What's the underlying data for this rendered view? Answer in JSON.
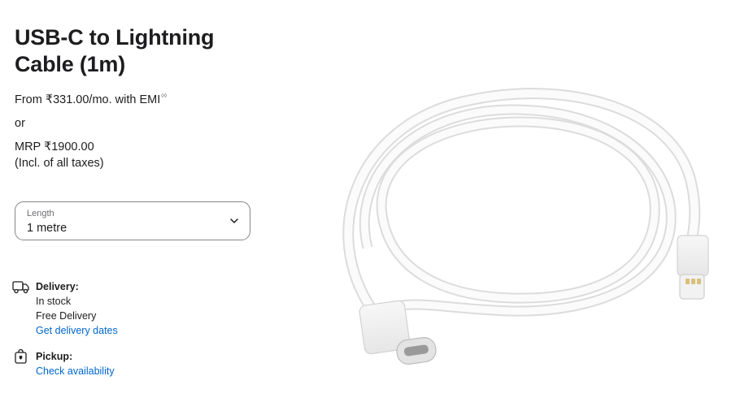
{
  "product": {
    "title_line1": "USB-C to Lightning",
    "title_line2": "Cable (1m)",
    "emi_text": "From ₹331.00/mo. with EMI",
    "emi_sup": "◊◊",
    "or_text": "or",
    "mrp_text": "MRP ₹1900.00",
    "tax_text": "(Incl. of all taxes)"
  },
  "length_select": {
    "label": "Length",
    "value": "1 metre",
    "icon": "chevron-down-icon"
  },
  "delivery": {
    "icon": "truck-icon",
    "heading": "Delivery:",
    "status": "In stock",
    "note": "Free Delivery",
    "link": "Get delivery dates"
  },
  "pickup": {
    "icon": "shopping-bag-icon",
    "heading": "Pickup:",
    "link": "Check availability"
  },
  "image": {
    "icon": "usb-c-lightning-cable-image"
  }
}
